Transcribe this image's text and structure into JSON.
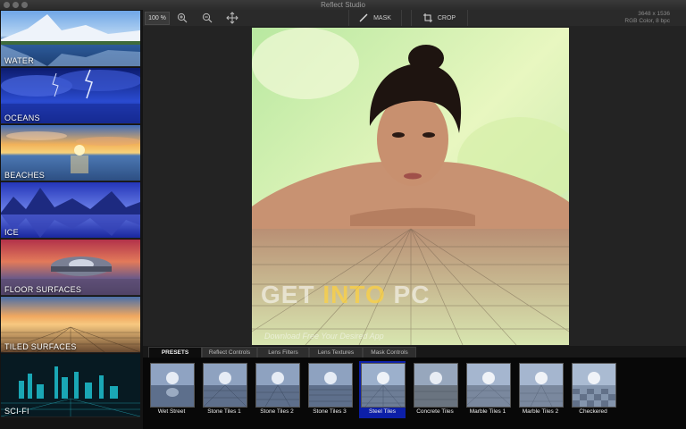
{
  "window": {
    "title": "Reflect Studio"
  },
  "toolbar": {
    "zoom_value": "100 %",
    "zoom_in_icon": "zoom-in-icon",
    "zoom_out_icon": "zoom-out-icon",
    "pan_icon": "move-icon",
    "mask_label": "MASK",
    "crop_label": "CROP",
    "image_size": "3648 x 1536",
    "image_mode": "RGB Color, 8 bpc"
  },
  "sidebar": {
    "categories": [
      {
        "label": "WATER"
      },
      {
        "label": "OCEANS"
      },
      {
        "label": "BEACHES"
      },
      {
        "label": "ICE"
      },
      {
        "label": "FLOOR SURFACES"
      },
      {
        "label": "TILED SURFACES"
      },
      {
        "label": "SCI-FI"
      }
    ]
  },
  "canvas": {
    "watermark_left": "GET",
    "watermark_mid": "INTO",
    "watermark_right": "PC",
    "watermark_sub": "Download Free Your Desired App"
  },
  "panel": {
    "tabs": [
      {
        "label": "PRESETS",
        "active": true
      },
      {
        "label": "Reflect Controls",
        "active": false
      },
      {
        "label": "Lens Filters",
        "active": false
      },
      {
        "label": "Lens Textures",
        "active": false
      },
      {
        "label": "Mask Controls",
        "active": false
      }
    ],
    "presets": [
      {
        "label": "Wet Street",
        "selected": false
      },
      {
        "label": "Stone Tiles 1",
        "selected": false
      },
      {
        "label": "Stone Tiles 2",
        "selected": false
      },
      {
        "label": "Stone Tiles 3",
        "selected": false
      },
      {
        "label": "Steel Tiles",
        "selected": true
      },
      {
        "label": "Concrete Tiles",
        "selected": false
      },
      {
        "label": "Marble Tiles 1",
        "selected": false
      },
      {
        "label": "Marble Tiles 2",
        "selected": false
      },
      {
        "label": "Checkered",
        "selected": false
      }
    ]
  },
  "colors": {
    "accent": "#0c1fa8",
    "background": "#1f1f1f"
  }
}
